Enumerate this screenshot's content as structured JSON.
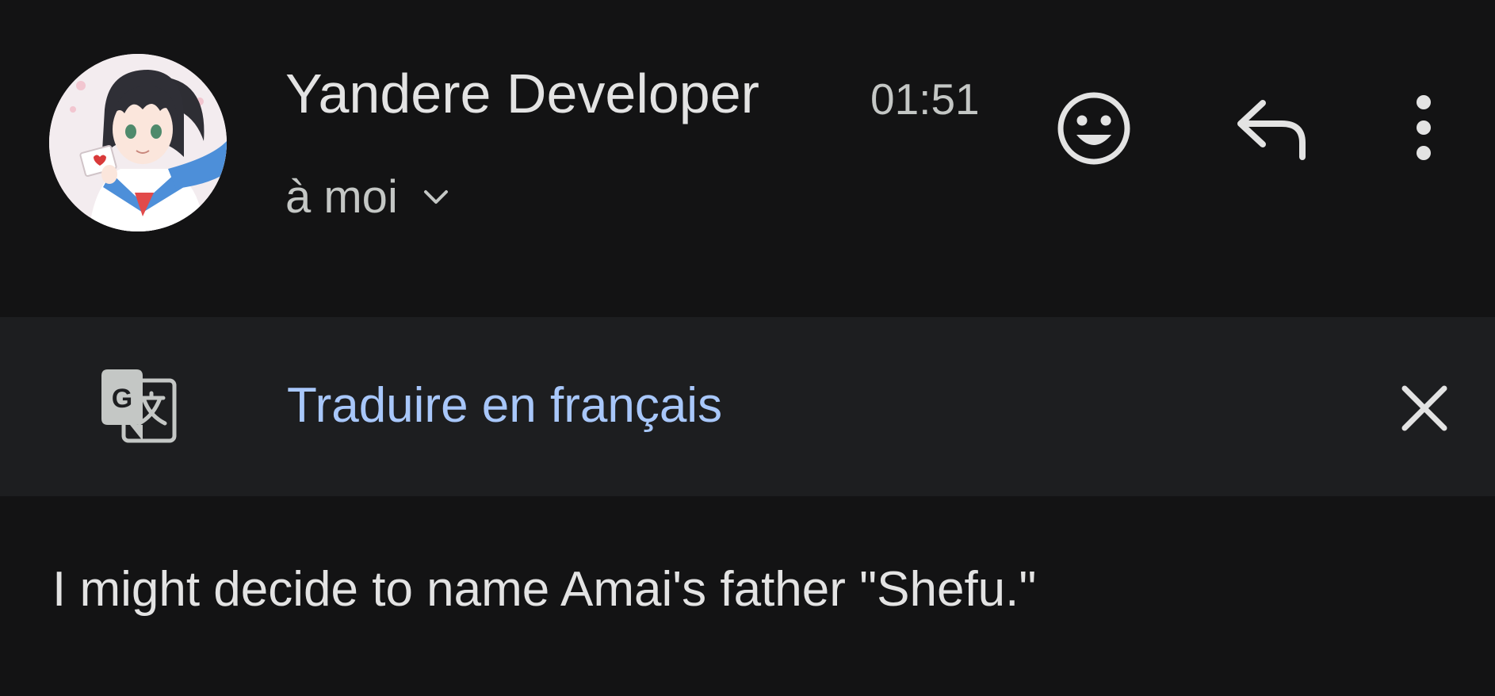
{
  "email": {
    "sender_name": "Yandere Developer",
    "time": "01:51",
    "recipient_label": "à moi",
    "body": "I might decide to name Amai's father \"Shefu.\""
  },
  "icons": {
    "avatar": "anime-girl-avatar",
    "recipient_toggle": "chevron-down-icon",
    "emoji": "smiley-face-icon",
    "reply": "reply-arrow-icon",
    "more": "vertical-dots-icon",
    "translate": "google-translate-icon",
    "close": "close-icon"
  },
  "translate_bar": {
    "link_label": "Traduire en français"
  },
  "colors": {
    "background": "#131314",
    "translate_bar_bg": "#1d1e20",
    "primary_text": "#e3e3e3",
    "secondary_text": "#c4c7c5",
    "link": "#a8c7fa"
  }
}
